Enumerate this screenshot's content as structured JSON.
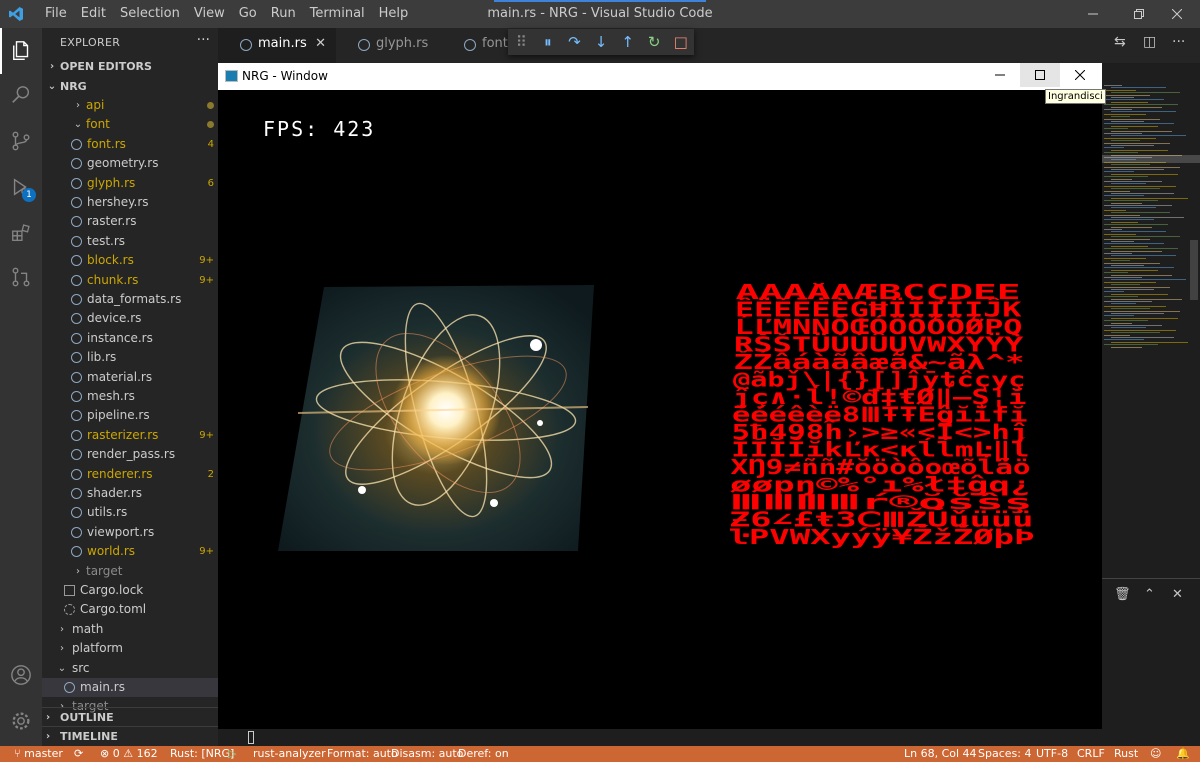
{
  "titlebar": {
    "menu": [
      "File",
      "Edit",
      "Selection",
      "View",
      "Go",
      "Run",
      "Terminal",
      "Help"
    ],
    "title": "main.rs - NRG - Visual Studio Code"
  },
  "sidebar": {
    "title": "EXPLORER",
    "more": "···",
    "open_editors": "OPEN EDITORS",
    "root": "NRG",
    "items": [
      {
        "label": "api",
        "type": "folder",
        "dec": "dot",
        "color": "#cca700"
      },
      {
        "label": "font",
        "type": "folder-open",
        "dec": "dot",
        "color": "#cca700"
      },
      {
        "label": "font.rs",
        "type": "file",
        "dec": "4",
        "color": "#cca700"
      },
      {
        "label": "geometry.rs",
        "type": "file",
        "dec": "",
        "color": "#cccccc"
      },
      {
        "label": "glyph.rs",
        "type": "file",
        "dec": "6",
        "color": "#cca700"
      },
      {
        "label": "hershey.rs",
        "type": "file",
        "dec": "",
        "color": "#cccccc"
      },
      {
        "label": "raster.rs",
        "type": "file",
        "dec": "",
        "color": "#cccccc"
      },
      {
        "label": "test.rs",
        "type": "file",
        "dec": "",
        "color": "#cccccc"
      },
      {
        "label": "block.rs",
        "type": "file",
        "dec": "9+",
        "color": "#cca700"
      },
      {
        "label": "chunk.rs",
        "type": "file",
        "dec": "9+",
        "color": "#cca700"
      },
      {
        "label": "data_formats.rs",
        "type": "file",
        "dec": "",
        "color": "#cccccc"
      },
      {
        "label": "device.rs",
        "type": "file",
        "dec": "",
        "color": "#cccccc"
      },
      {
        "label": "instance.rs",
        "type": "file",
        "dec": "",
        "color": "#cccccc"
      },
      {
        "label": "lib.rs",
        "type": "file",
        "dec": "",
        "color": "#cccccc"
      },
      {
        "label": "material.rs",
        "type": "file",
        "dec": "",
        "color": "#cccccc"
      },
      {
        "label": "mesh.rs",
        "type": "file",
        "dec": "",
        "color": "#cccccc"
      },
      {
        "label": "pipeline.rs",
        "type": "file",
        "dec": "",
        "color": "#cccccc"
      },
      {
        "label": "rasterizer.rs",
        "type": "file",
        "dec": "9+",
        "color": "#cca700"
      },
      {
        "label": "render_pass.rs",
        "type": "file",
        "dec": "",
        "color": "#cccccc"
      },
      {
        "label": "renderer.rs",
        "type": "file",
        "dec": "2",
        "color": "#cca700"
      },
      {
        "label": "shader.rs",
        "type": "file",
        "dec": "",
        "color": "#cccccc"
      },
      {
        "label": "utils.rs",
        "type": "file",
        "dec": "",
        "color": "#cccccc"
      },
      {
        "label": "viewport.rs",
        "type": "file",
        "dec": "",
        "color": "#cccccc"
      },
      {
        "label": "world.rs",
        "type": "file",
        "dec": "9+",
        "color": "#cca700"
      },
      {
        "label": "target",
        "type": "folder",
        "dec": "",
        "color": "#8b8b8b"
      },
      {
        "label": "Cargo.lock",
        "type": "lock",
        "dec": "",
        "color": "#cccccc"
      },
      {
        "label": "Cargo.toml",
        "type": "gear",
        "dec": "",
        "color": "#cccccc"
      },
      {
        "label": "math",
        "type": "top-folder",
        "dec": "",
        "color": "#cccccc"
      },
      {
        "label": "platform",
        "type": "top-folder",
        "dec": "",
        "color": "#cccccc"
      },
      {
        "label": "src",
        "type": "top-folder-open",
        "dec": "",
        "color": "#cccccc"
      },
      {
        "label": "main.rs",
        "type": "selected-file",
        "dec": "",
        "color": "#cccccc"
      },
      {
        "label": "target",
        "type": "top-folder",
        "dec": "",
        "color": "#8b8b8b"
      }
    ],
    "outline": "OUTLINE",
    "timeline": "TIMELINE"
  },
  "tabs": [
    {
      "label": "main.rs",
      "close": "✕"
    },
    {
      "label": "glyph.rs"
    },
    {
      "label": "font.rs"
    }
  ],
  "nrg_window": {
    "title": "NRG - Window",
    "fps_label": "FPS:",
    "fps_value": "423",
    "tooltip": "Ingrandisci",
    "glyph_rows": [
      "ÂÃÄÅÃÆBCÇDÉÉ",
      "ÊËÈĒĖÈĢĦÏĨĮĪĮĴK",
      "ĹĽMNNŎŒÓÖÔÕÖØPQ",
      "RŠŠTÜÙÚÛŲVWXYŸÝ",
      "ŽŹâáàãâæã&~ãλ^*",
      "@ãbǰ\\|{}[]ĵȳȶĉçyç",
      "ĵç∧·ĺ!©đ‡ŧØ‖—Ş¦ĭ",
      "ĕééêèë8ⅢŦŦĒĝĭĭfĭ",
      "5ħ498ĥ›>≥«<Ĭ<>hĵ",
      "ĬĬĬĬĭkĽĸ<ĸĺĺmĿ‖ĺ",
      "XŊ9≠ññ#ŏöòôoœõĺãö",
      "øøpŋ©%°ı%ł‡ĝq¿",
      "ⅢⅢⅢⅢŕ®ŏšŝş",
      "Ƶ6∠£ŧ3ⅭⅢŽŬǔüüü",
      "ŀPVWXyýÿ¥ŽžŽØþÞ"
    ]
  },
  "right_panel": {
    "trash": "🗑",
    "up": "⌃",
    "close": "✕"
  },
  "statusbar": {
    "branch": "master",
    "sync": "⟳",
    "errors": "0",
    "warnings": "162",
    "rust_target": "Rust: [NRG]",
    "play": "▷",
    "analyzer": "rust-analyzer",
    "format": "Format: auto",
    "disasm": "Disasm: auto",
    "deref": "Deref: on",
    "position": "Ln 68, Col 44",
    "spaces": "Spaces: 4",
    "encoding": "UTF-8",
    "eol": "CRLF",
    "language": "Rust",
    "feedback": "☺",
    "bell": "🔔"
  },
  "colors": {
    "statusbar": "#cc6633",
    "glyph_red": "#ff0000",
    "modified": "#cca700",
    "activity_bar": "#333333",
    "sidebar": "#252526"
  }
}
